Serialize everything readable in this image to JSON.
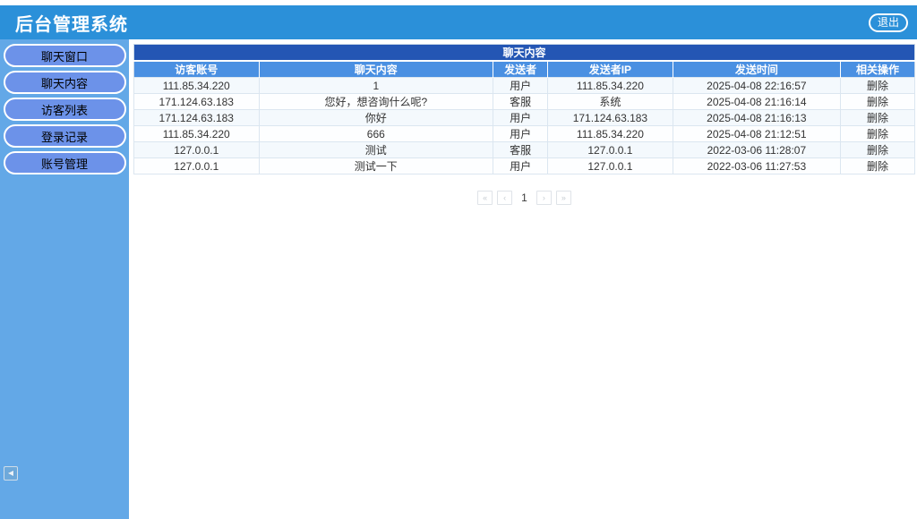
{
  "header": {
    "title": "后台管理系统",
    "logout_label": "退出"
  },
  "sidebar": {
    "items": [
      {
        "label": "聊天窗口"
      },
      {
        "label": "聊天内容"
      },
      {
        "label": "访客列表"
      },
      {
        "label": "登录记录"
      },
      {
        "label": "账号管理"
      }
    ],
    "collapse_icon": "◀"
  },
  "table": {
    "title": "聊天内容",
    "columns": [
      "访客账号",
      "聊天内容",
      "发送者",
      "发送者IP",
      "发送时间",
      "相关操作"
    ],
    "rows": [
      [
        "111.85.34.220",
        "1",
        "用户",
        "111.85.34.220",
        "2025-04-08 22:16:57",
        "删除"
      ],
      [
        "171.124.63.183",
        "您好，想咨询什么呢?",
        "客服",
        "系统",
        "2025-04-08 21:16:14",
        "删除"
      ],
      [
        "171.124.63.183",
        "你好",
        "用户",
        "171.124.63.183",
        "2025-04-08 21:16:13",
        "删除"
      ],
      [
        "111.85.34.220",
        "666",
        "用户",
        "111.85.34.220",
        "2025-04-08 21:12:51",
        "删除"
      ],
      [
        "127.0.0.1",
        "测试",
        "客服",
        "127.0.0.1",
        "2022-03-06 11:28:07",
        "删除"
      ],
      [
        "127.0.0.1",
        "测试一下",
        "用户",
        "127.0.0.1",
        "2022-03-06 11:27:53",
        "删除"
      ]
    ]
  },
  "pagination": {
    "first": "«",
    "prev": "‹",
    "current": "1",
    "next": "›",
    "last": "»"
  },
  "colors": {
    "header_bg": "#2b90d9",
    "sidebar_bg": "#63a8e7",
    "sidebar_button_bg": "#6c92e9",
    "table_title_bg": "#2456b4",
    "table_header_bg": "#4a90e2",
    "row_odd_bg": "#f4f9fd",
    "row_even_bg": "#fdfeff"
  }
}
